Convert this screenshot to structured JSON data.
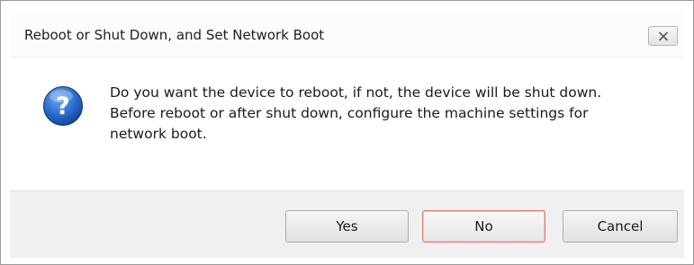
{
  "window": {
    "title": "Reboot or Shut Down, and Set Network Boot",
    "close_icon": "close-icon"
  },
  "dialog": {
    "icon": "question-icon",
    "message_lines": [
      "Do you want the device to reboot, if not, the device will be shut down.",
      "Before reboot or after shut down, configure the machine settings for",
      "network boot."
    ]
  },
  "buttons": {
    "yes": "Yes",
    "no": "No",
    "cancel": "Cancel",
    "focused": "No"
  },
  "colors": {
    "focus_border": "#e07a7a",
    "icon_blue": "#1f5fb8",
    "button_bar_bg": "#f0f0f0"
  }
}
